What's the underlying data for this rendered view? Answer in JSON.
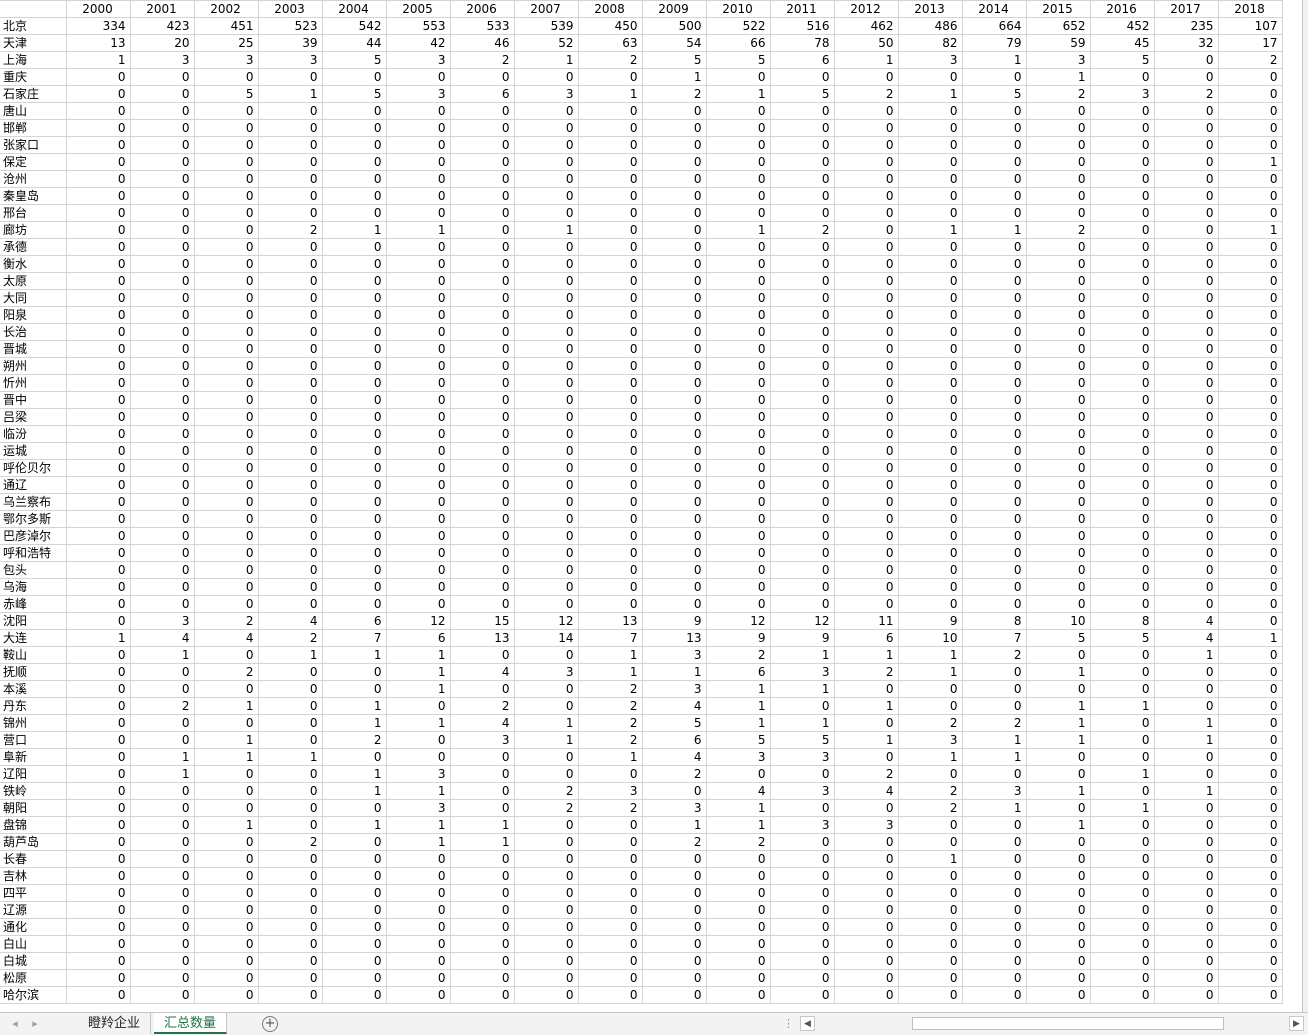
{
  "years": [
    "2000",
    "2001",
    "2002",
    "2003",
    "2004",
    "2005",
    "2006",
    "2007",
    "2008",
    "2009",
    "2010",
    "2011",
    "2012",
    "2013",
    "2014",
    "2015",
    "2016",
    "2017",
    "2018"
  ],
  "rows": [
    {
      "city": "北京",
      "values": [
        334,
        423,
        451,
        523,
        542,
        553,
        533,
        539,
        450,
        500,
        522,
        516,
        462,
        486,
        664,
        652,
        452,
        235,
        107
      ]
    },
    {
      "city": "天津",
      "values": [
        13,
        20,
        25,
        39,
        44,
        42,
        46,
        52,
        63,
        54,
        66,
        78,
        50,
        82,
        79,
        59,
        45,
        32,
        17
      ]
    },
    {
      "city": "上海",
      "values": [
        1,
        3,
        3,
        3,
        5,
        3,
        2,
        1,
        2,
        5,
        5,
        6,
        1,
        3,
        1,
        3,
        5,
        0,
        2
      ]
    },
    {
      "city": "重庆",
      "values": [
        0,
        0,
        0,
        0,
        0,
        0,
        0,
        0,
        0,
        1,
        0,
        0,
        0,
        0,
        0,
        1,
        0,
        0,
        0
      ]
    },
    {
      "city": "石家庄",
      "values": [
        0,
        0,
        5,
        1,
        5,
        3,
        6,
        3,
        1,
        2,
        1,
        5,
        2,
        1,
        5,
        2,
        3,
        2,
        0
      ]
    },
    {
      "city": "唐山",
      "values": [
        0,
        0,
        0,
        0,
        0,
        0,
        0,
        0,
        0,
        0,
        0,
        0,
        0,
        0,
        0,
        0,
        0,
        0,
        0
      ]
    },
    {
      "city": "邯郸",
      "values": [
        0,
        0,
        0,
        0,
        0,
        0,
        0,
        0,
        0,
        0,
        0,
        0,
        0,
        0,
        0,
        0,
        0,
        0,
        0
      ]
    },
    {
      "city": "张家口",
      "values": [
        0,
        0,
        0,
        0,
        0,
        0,
        0,
        0,
        0,
        0,
        0,
        0,
        0,
        0,
        0,
        0,
        0,
        0,
        0
      ]
    },
    {
      "city": "保定",
      "values": [
        0,
        0,
        0,
        0,
        0,
        0,
        0,
        0,
        0,
        0,
        0,
        0,
        0,
        0,
        0,
        0,
        0,
        0,
        1
      ]
    },
    {
      "city": "沧州",
      "values": [
        0,
        0,
        0,
        0,
        0,
        0,
        0,
        0,
        0,
        0,
        0,
        0,
        0,
        0,
        0,
        0,
        0,
        0,
        0
      ]
    },
    {
      "city": "秦皇岛",
      "values": [
        0,
        0,
        0,
        0,
        0,
        0,
        0,
        0,
        0,
        0,
        0,
        0,
        0,
        0,
        0,
        0,
        0,
        0,
        0
      ]
    },
    {
      "city": "邢台",
      "values": [
        0,
        0,
        0,
        0,
        0,
        0,
        0,
        0,
        0,
        0,
        0,
        0,
        0,
        0,
        0,
        0,
        0,
        0,
        0
      ]
    },
    {
      "city": "廊坊",
      "values": [
        0,
        0,
        0,
        2,
        1,
        1,
        0,
        1,
        0,
        0,
        1,
        2,
        0,
        1,
        1,
        2,
        0,
        0,
        1
      ]
    },
    {
      "city": "承德",
      "values": [
        0,
        0,
        0,
        0,
        0,
        0,
        0,
        0,
        0,
        0,
        0,
        0,
        0,
        0,
        0,
        0,
        0,
        0,
        0
      ]
    },
    {
      "city": "衡水",
      "values": [
        0,
        0,
        0,
        0,
        0,
        0,
        0,
        0,
        0,
        0,
        0,
        0,
        0,
        0,
        0,
        0,
        0,
        0,
        0
      ]
    },
    {
      "city": "太原",
      "values": [
        0,
        0,
        0,
        0,
        0,
        0,
        0,
        0,
        0,
        0,
        0,
        0,
        0,
        0,
        0,
        0,
        0,
        0,
        0
      ]
    },
    {
      "city": "大同",
      "values": [
        0,
        0,
        0,
        0,
        0,
        0,
        0,
        0,
        0,
        0,
        0,
        0,
        0,
        0,
        0,
        0,
        0,
        0,
        0
      ]
    },
    {
      "city": "阳泉",
      "values": [
        0,
        0,
        0,
        0,
        0,
        0,
        0,
        0,
        0,
        0,
        0,
        0,
        0,
        0,
        0,
        0,
        0,
        0,
        0
      ]
    },
    {
      "city": "长治",
      "values": [
        0,
        0,
        0,
        0,
        0,
        0,
        0,
        0,
        0,
        0,
        0,
        0,
        0,
        0,
        0,
        0,
        0,
        0,
        0
      ]
    },
    {
      "city": "晋城",
      "values": [
        0,
        0,
        0,
        0,
        0,
        0,
        0,
        0,
        0,
        0,
        0,
        0,
        0,
        0,
        0,
        0,
        0,
        0,
        0
      ]
    },
    {
      "city": "朔州",
      "values": [
        0,
        0,
        0,
        0,
        0,
        0,
        0,
        0,
        0,
        0,
        0,
        0,
        0,
        0,
        0,
        0,
        0,
        0,
        0
      ]
    },
    {
      "city": "忻州",
      "values": [
        0,
        0,
        0,
        0,
        0,
        0,
        0,
        0,
        0,
        0,
        0,
        0,
        0,
        0,
        0,
        0,
        0,
        0,
        0
      ]
    },
    {
      "city": "晋中",
      "values": [
        0,
        0,
        0,
        0,
        0,
        0,
        0,
        0,
        0,
        0,
        0,
        0,
        0,
        0,
        0,
        0,
        0,
        0,
        0
      ]
    },
    {
      "city": "吕梁",
      "values": [
        0,
        0,
        0,
        0,
        0,
        0,
        0,
        0,
        0,
        0,
        0,
        0,
        0,
        0,
        0,
        0,
        0,
        0,
        0
      ]
    },
    {
      "city": "临汾",
      "values": [
        0,
        0,
        0,
        0,
        0,
        0,
        0,
        0,
        0,
        0,
        0,
        0,
        0,
        0,
        0,
        0,
        0,
        0,
        0
      ]
    },
    {
      "city": "运城",
      "values": [
        0,
        0,
        0,
        0,
        0,
        0,
        0,
        0,
        0,
        0,
        0,
        0,
        0,
        0,
        0,
        0,
        0,
        0,
        0
      ]
    },
    {
      "city": "呼伦贝尔",
      "values": [
        0,
        0,
        0,
        0,
        0,
        0,
        0,
        0,
        0,
        0,
        0,
        0,
        0,
        0,
        0,
        0,
        0,
        0,
        0
      ]
    },
    {
      "city": "通辽",
      "values": [
        0,
        0,
        0,
        0,
        0,
        0,
        0,
        0,
        0,
        0,
        0,
        0,
        0,
        0,
        0,
        0,
        0,
        0,
        0
      ]
    },
    {
      "city": "乌兰察布",
      "values": [
        0,
        0,
        0,
        0,
        0,
        0,
        0,
        0,
        0,
        0,
        0,
        0,
        0,
        0,
        0,
        0,
        0,
        0,
        0
      ]
    },
    {
      "city": "鄂尔多斯",
      "values": [
        0,
        0,
        0,
        0,
        0,
        0,
        0,
        0,
        0,
        0,
        0,
        0,
        0,
        0,
        0,
        0,
        0,
        0,
        0
      ]
    },
    {
      "city": "巴彦淖尔",
      "values": [
        0,
        0,
        0,
        0,
        0,
        0,
        0,
        0,
        0,
        0,
        0,
        0,
        0,
        0,
        0,
        0,
        0,
        0,
        0
      ]
    },
    {
      "city": "呼和浩特",
      "values": [
        0,
        0,
        0,
        0,
        0,
        0,
        0,
        0,
        0,
        0,
        0,
        0,
        0,
        0,
        0,
        0,
        0,
        0,
        0
      ]
    },
    {
      "city": "包头",
      "values": [
        0,
        0,
        0,
        0,
        0,
        0,
        0,
        0,
        0,
        0,
        0,
        0,
        0,
        0,
        0,
        0,
        0,
        0,
        0
      ]
    },
    {
      "city": "乌海",
      "values": [
        0,
        0,
        0,
        0,
        0,
        0,
        0,
        0,
        0,
        0,
        0,
        0,
        0,
        0,
        0,
        0,
        0,
        0,
        0
      ]
    },
    {
      "city": "赤峰",
      "values": [
        0,
        0,
        0,
        0,
        0,
        0,
        0,
        0,
        0,
        0,
        0,
        0,
        0,
        0,
        0,
        0,
        0,
        0,
        0
      ]
    },
    {
      "city": "沈阳",
      "values": [
        0,
        3,
        2,
        4,
        6,
        12,
        15,
        12,
        13,
        9,
        12,
        12,
        11,
        9,
        8,
        10,
        8,
        4,
        0
      ]
    },
    {
      "city": "大连",
      "values": [
        1,
        4,
        4,
        2,
        7,
        6,
        13,
        14,
        7,
        13,
        9,
        9,
        6,
        10,
        7,
        5,
        5,
        4,
        1
      ]
    },
    {
      "city": "鞍山",
      "values": [
        0,
        1,
        0,
        1,
        1,
        1,
        0,
        0,
        1,
        3,
        2,
        1,
        1,
        1,
        2,
        0,
        0,
        1,
        0
      ]
    },
    {
      "city": "抚顺",
      "values": [
        0,
        0,
        2,
        0,
        0,
        1,
        4,
        3,
        1,
        1,
        6,
        3,
        2,
        1,
        0,
        1,
        0,
        0,
        0
      ]
    },
    {
      "city": "本溪",
      "values": [
        0,
        0,
        0,
        0,
        0,
        1,
        0,
        0,
        2,
        3,
        1,
        1,
        0,
        0,
        0,
        0,
        0,
        0,
        0
      ]
    },
    {
      "city": "丹东",
      "values": [
        0,
        2,
        1,
        0,
        1,
        0,
        2,
        0,
        2,
        4,
        1,
        0,
        1,
        0,
        0,
        1,
        1,
        0,
        0
      ]
    },
    {
      "city": "锦州",
      "values": [
        0,
        0,
        0,
        0,
        1,
        1,
        4,
        1,
        2,
        5,
        1,
        1,
        0,
        2,
        2,
        1,
        0,
        1,
        0
      ]
    },
    {
      "city": "营口",
      "values": [
        0,
        0,
        1,
        0,
        2,
        0,
        3,
        1,
        2,
        6,
        5,
        5,
        1,
        3,
        1,
        1,
        0,
        1,
        0
      ]
    },
    {
      "city": "阜新",
      "values": [
        0,
        1,
        1,
        1,
        0,
        0,
        0,
        0,
        1,
        4,
        3,
        3,
        0,
        1,
        1,
        0,
        0,
        0,
        0
      ]
    },
    {
      "city": "辽阳",
      "values": [
        0,
        1,
        0,
        0,
        1,
        3,
        0,
        0,
        0,
        2,
        0,
        0,
        2,
        0,
        0,
        0,
        1,
        0,
        0
      ]
    },
    {
      "city": "铁岭",
      "values": [
        0,
        0,
        0,
        0,
        1,
        1,
        0,
        2,
        3,
        0,
        4,
        3,
        4,
        2,
        3,
        1,
        0,
        1,
        0
      ]
    },
    {
      "city": "朝阳",
      "values": [
        0,
        0,
        0,
        0,
        0,
        3,
        0,
        2,
        2,
        3,
        1,
        0,
        0,
        2,
        1,
        0,
        1,
        0,
        0
      ]
    },
    {
      "city": "盘锦",
      "values": [
        0,
        0,
        1,
        0,
        1,
        1,
        1,
        0,
        0,
        1,
        1,
        3,
        3,
        0,
        0,
        1,
        0,
        0,
        0
      ]
    },
    {
      "city": "葫芦岛",
      "values": [
        0,
        0,
        0,
        2,
        0,
        1,
        1,
        0,
        0,
        2,
        2,
        0,
        0,
        0,
        0,
        0,
        0,
        0,
        0
      ]
    },
    {
      "city": "长春",
      "values": [
        0,
        0,
        0,
        0,
        0,
        0,
        0,
        0,
        0,
        0,
        0,
        0,
        0,
        1,
        0,
        0,
        0,
        0,
        0
      ]
    },
    {
      "city": "吉林",
      "values": [
        0,
        0,
        0,
        0,
        0,
        0,
        0,
        0,
        0,
        0,
        0,
        0,
        0,
        0,
        0,
        0,
        0,
        0,
        0
      ]
    },
    {
      "city": "四平",
      "values": [
        0,
        0,
        0,
        0,
        0,
        0,
        0,
        0,
        0,
        0,
        0,
        0,
        0,
        0,
        0,
        0,
        0,
        0,
        0
      ]
    },
    {
      "city": "辽源",
      "values": [
        0,
        0,
        0,
        0,
        0,
        0,
        0,
        0,
        0,
        0,
        0,
        0,
        0,
        0,
        0,
        0,
        0,
        0,
        0
      ]
    },
    {
      "city": "通化",
      "values": [
        0,
        0,
        0,
        0,
        0,
        0,
        0,
        0,
        0,
        0,
        0,
        0,
        0,
        0,
        0,
        0,
        0,
        0,
        0
      ]
    },
    {
      "city": "白山",
      "values": [
        0,
        0,
        0,
        0,
        0,
        0,
        0,
        0,
        0,
        0,
        0,
        0,
        0,
        0,
        0,
        0,
        0,
        0,
        0
      ]
    },
    {
      "city": "白城",
      "values": [
        0,
        0,
        0,
        0,
        0,
        0,
        0,
        0,
        0,
        0,
        0,
        0,
        0,
        0,
        0,
        0,
        0,
        0,
        0
      ]
    },
    {
      "city": "松原",
      "values": [
        0,
        0,
        0,
        0,
        0,
        0,
        0,
        0,
        0,
        0,
        0,
        0,
        0,
        0,
        0,
        0,
        0,
        0,
        0
      ]
    },
    {
      "city": "哈尔滨",
      "values": [
        0,
        0,
        0,
        0,
        0,
        0,
        0,
        0,
        0,
        0,
        0,
        0,
        0,
        0,
        0,
        0,
        0,
        0,
        0
      ]
    }
  ],
  "sheet_tabs": [
    {
      "label": "瞪羚企业",
      "active": false
    },
    {
      "label": "汇总数量",
      "active": true
    }
  ],
  "icons": {
    "prev_sheet": "triangle-left-icon",
    "next_sheet": "triangle-right-icon",
    "add_sheet": "plus-circle-icon",
    "scroll_left": "arrow-left-icon",
    "scroll_right": "arrow-right-icon"
  },
  "colors": {
    "active_tab": "#217346",
    "gridline": "#d4d4d4"
  }
}
